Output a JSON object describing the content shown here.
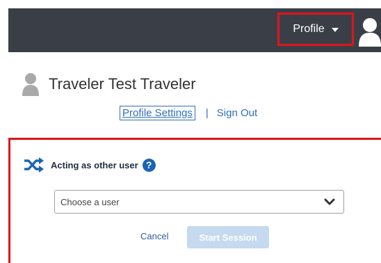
{
  "topbar": {
    "profile_label": "Profile",
    "profile_icon": "chevron-down-icon",
    "avatar_icon": "user-avatar-icon"
  },
  "user": {
    "name": "Traveler Test Traveler",
    "avatar_icon": "user-avatar-icon"
  },
  "links": {
    "profile_settings": "Profile Settings",
    "separator": "|",
    "sign_out": "Sign Out"
  },
  "acting": {
    "icon": "shuffle-icon",
    "title": "Acting as other user",
    "help_icon": "question-circle-icon",
    "help_glyph": "?",
    "select_placeholder": "Choose a user",
    "cancel_label": "Cancel",
    "start_label": "Start Session"
  },
  "colors": {
    "topbar_bg": "#3a3f47",
    "highlight_red": "#e0141b",
    "link_blue": "#2f6fb8",
    "disabled_button": "#c5d9ef"
  }
}
